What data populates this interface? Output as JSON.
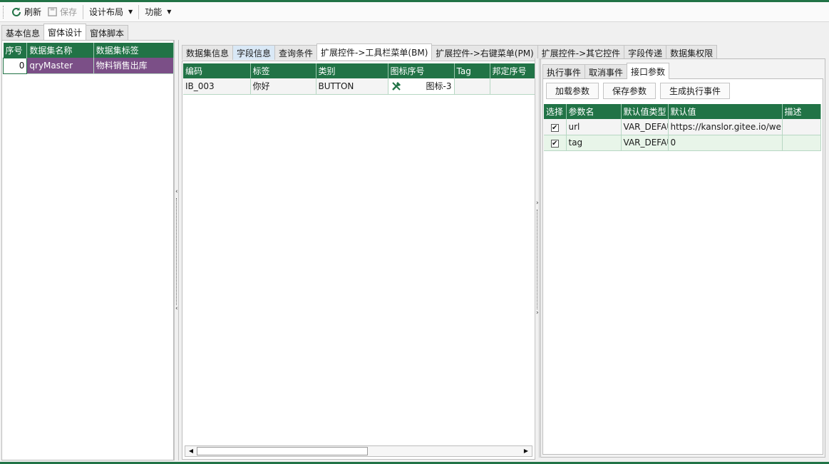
{
  "toolbar": {
    "refresh_label": "刷新",
    "save_label": "保存",
    "layout_label": "设计布局",
    "function_label": "功能"
  },
  "top_tabs": [
    "基本信息",
    "窗体设计",
    "窗体脚本"
  ],
  "left_grid": {
    "columns": [
      "序号",
      "数据集名称",
      "数据集标签"
    ],
    "rows": [
      {
        "index": "0",
        "name": "qryMaster",
        "label": "物料销售出库"
      }
    ]
  },
  "mid_tabs": [
    "数据集信息",
    "字段信息",
    "查询条件",
    "扩展控件->工具栏菜单(BM)",
    "扩展控件->右键菜单(PM)",
    "扩展控件->其它控件",
    "字段传递",
    "数据集权限"
  ],
  "mid_grid": {
    "columns": [
      "编码",
      "标签",
      "类别",
      "图标序号",
      "Tag",
      "邦定序号"
    ],
    "rows": [
      {
        "code": "IB_003",
        "label": "你好",
        "type": "BUTTON",
        "icon": "图标-3",
        "tag": "",
        "bind": ""
      }
    ]
  },
  "right_tabs": [
    "执行事件",
    "取消事件",
    "接口参数"
  ],
  "right_buttons": [
    "加载参数",
    "保存参数",
    "生成执行事件"
  ],
  "param_grid": {
    "columns": [
      "选择",
      "参数名",
      "默认值类型",
      "默认值",
      "描述"
    ],
    "rows": [
      {
        "checked": true,
        "name": "url",
        "type": "VAR_DEFAULT",
        "value": "https://kanslor.gitee.io/web",
        "desc": ""
      },
      {
        "checked": true,
        "name": "tag",
        "type": "VAR_DEFAULT",
        "value": "0",
        "desc": ""
      }
    ]
  },
  "colors": {
    "accent": "#217346",
    "selection": "#7b4f87"
  }
}
